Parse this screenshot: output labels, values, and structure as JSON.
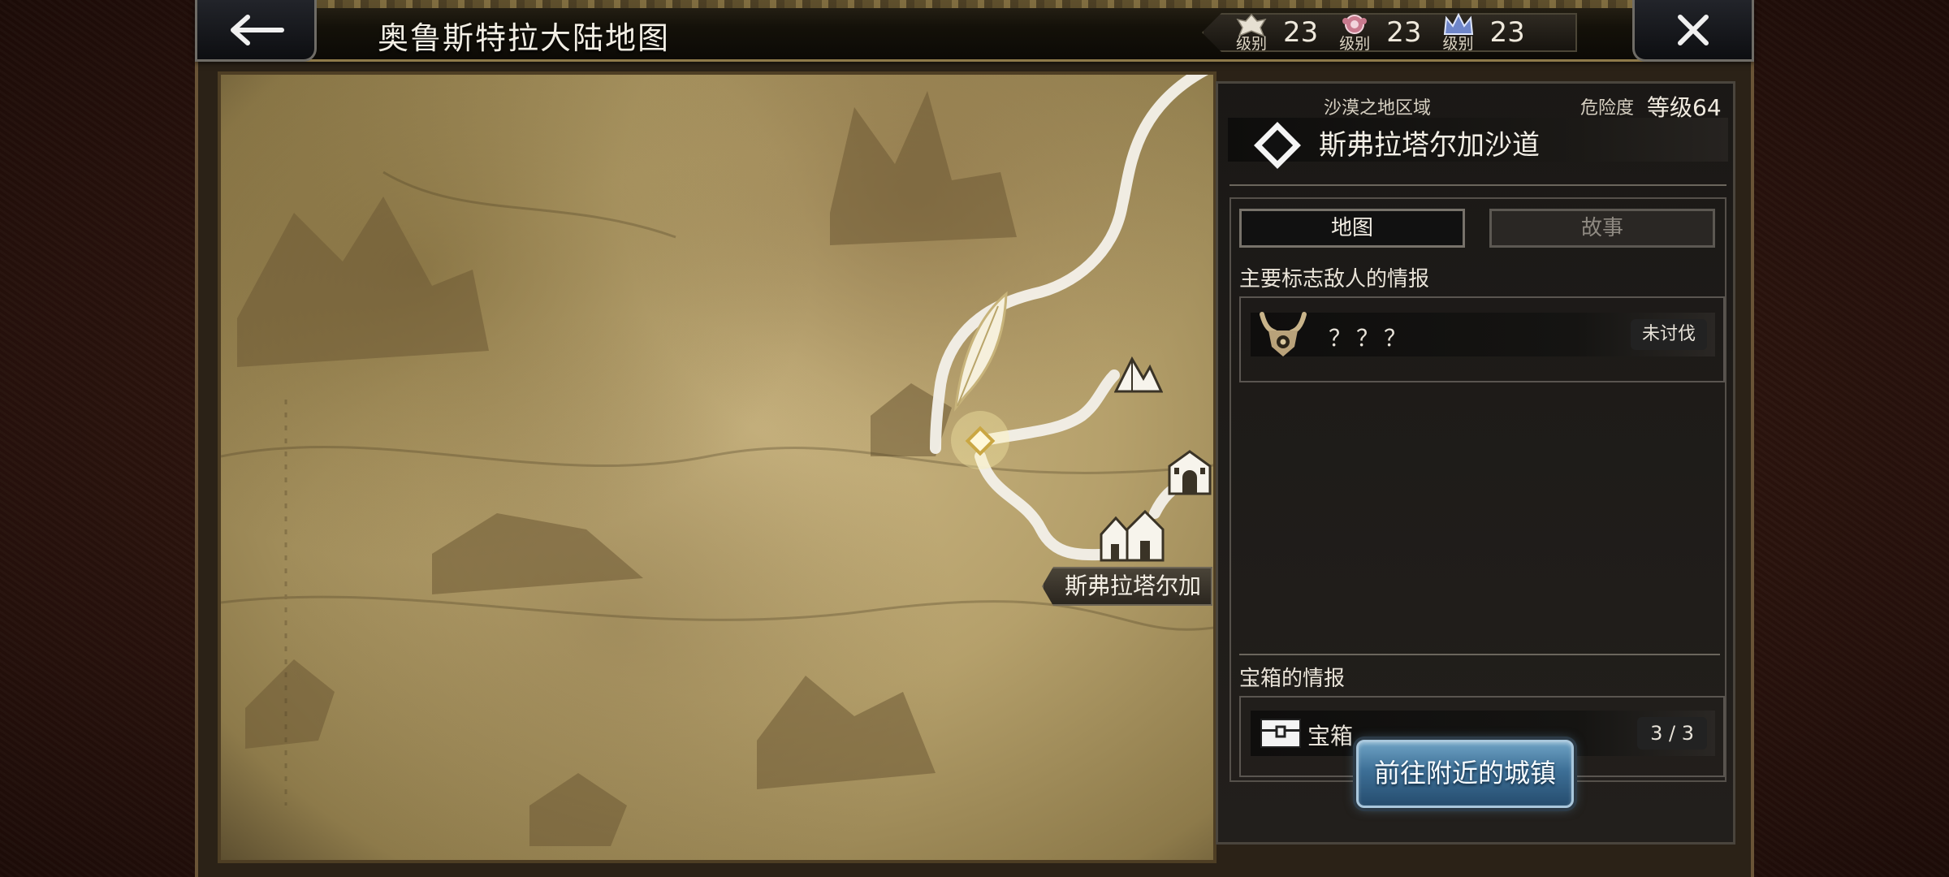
{
  "header": {
    "title": "奥鲁斯特拉大陆地图",
    "back_icon": "arrow-left-icon",
    "close_icon": "close-icon",
    "levels": [
      {
        "icon": "crest-icon",
        "word": "级别",
        "value": "23"
      },
      {
        "icon": "rose-emblem-icon",
        "word": "级别",
        "value": "23"
      },
      {
        "icon": "crown-emblem-icon",
        "word": "级别",
        "value": "23"
      }
    ]
  },
  "map": {
    "town_label": "斯弗拉塔尔加",
    "icons": [
      "feather-quill-icon",
      "current-location-diamond-icon",
      "camp-tent-icon",
      "castle-gate-icon",
      "town-houses-icon"
    ]
  },
  "panel": {
    "region": "沙漠之地区域",
    "danger_label": "危险度",
    "danger_level": "等级64",
    "area_name": "斯弗拉塔尔加沙道",
    "tabs": {
      "map": "地图",
      "story": "故事"
    },
    "enemy_section_title": "主要标志敌人的情报",
    "enemy": {
      "name": "？？？",
      "status": "未讨伐",
      "icon": "horned-demon-icon"
    },
    "chest_section_title": "宝箱的情报",
    "chest": {
      "name": "宝箱",
      "count": "3 / 3",
      "icon": "treasure-chest-icon"
    },
    "go_town_button": "前往附近的城镇"
  },
  "colors": {
    "accent_blue": "#3d6f96",
    "gold_trim": "#8f7a4a",
    "parchment": "#cbb682",
    "panel_bg": "#1a1816"
  }
}
